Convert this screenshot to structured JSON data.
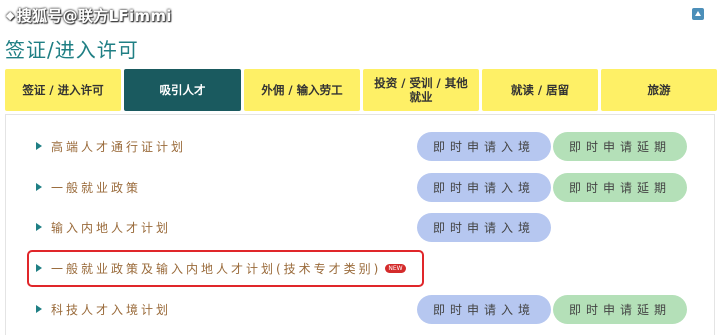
{
  "watermark": {
    "text": "搜狐号@联方LFimmi"
  },
  "page": {
    "title": "签证/进入许可"
  },
  "tabs": [
    {
      "label": "签证 / 进入许可",
      "active": false
    },
    {
      "label": "吸引人才",
      "active": true
    },
    {
      "label": "外佣 / 输入劳工",
      "active": false
    },
    {
      "label": "投资 / 受训 / 其他就业",
      "active": false
    },
    {
      "label": "就读 / 居留",
      "active": false
    },
    {
      "label": "旅游",
      "active": false
    }
  ],
  "schemes": [
    {
      "label": "高端人才通行证计划",
      "entry_button": "即时申请入境",
      "extend_button": "即时申请延期"
    },
    {
      "label": "一般就业政策",
      "entry_button": "即时申请入境",
      "extend_button": "即时申请延期"
    },
    {
      "label": "输入内地人才计划",
      "entry_button": "即时申请入境",
      "extend_button": ""
    },
    {
      "label": "一般就业政策及输入内地人才计划(技术专才类别)",
      "badge": "NEW",
      "highlighted": true
    },
    {
      "label": "科技人才入境计划",
      "entry_button": "即时申请入境",
      "extend_button": "即时申请延期"
    }
  ],
  "colors": {
    "accent": "#1f7f84",
    "tab_bg": "#fef066",
    "tab_active_bg": "#1a5a5f",
    "entry_button": "#b6c7f0",
    "extend_button": "#b4e0b8",
    "highlight_border": "#e0262a"
  },
  "icons": {
    "top_right": "scroll-top-icon",
    "row_marker": "triangle-right-icon"
  }
}
